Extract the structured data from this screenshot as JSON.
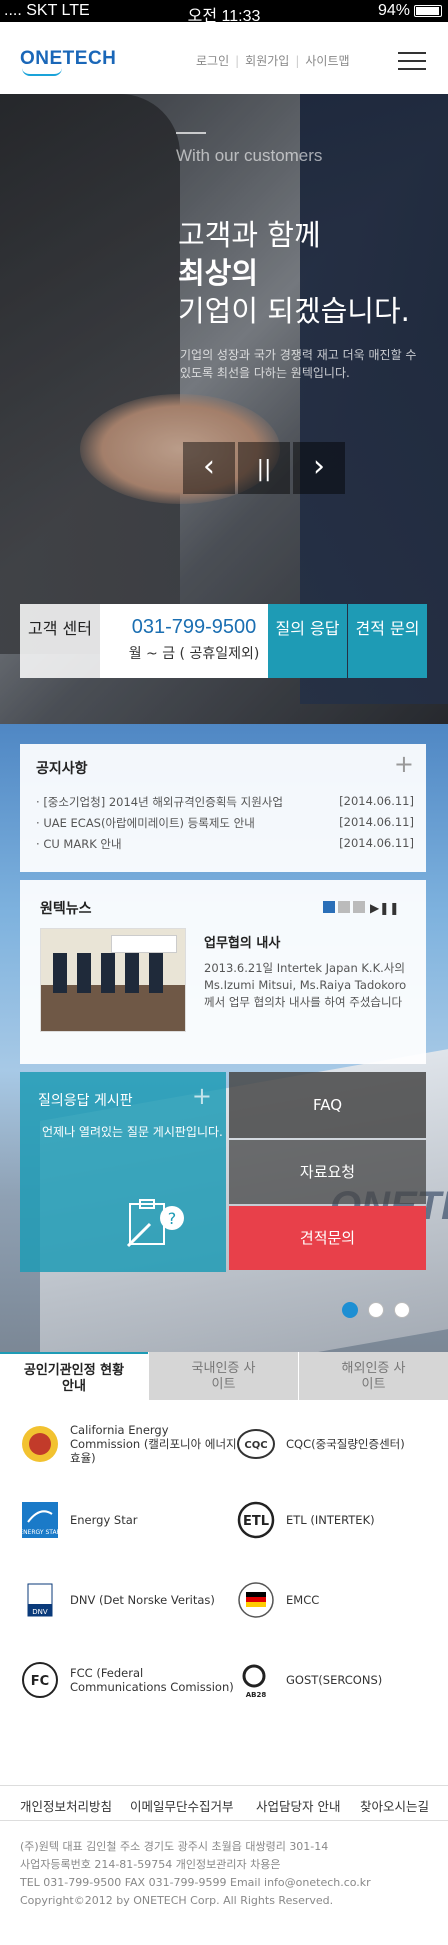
{
  "statusbar": {
    "signal": ".... SKT  LTE",
    "time": "오전 11:33",
    "battery": "94%"
  },
  "header": {
    "logo": "ONETECH",
    "links": [
      "로그인",
      "회원가입",
      "사이트맵"
    ],
    "menu_icon": "hamburger-icon"
  },
  "hero": {
    "subtitle": "With our customers",
    "headline_1": "고객과 함께",
    "headline_2": "최상의",
    "headline_3": "기업이 되겠습니다.",
    "description": "기업의 성장과 국가 경쟁력 재고 더욱 매진할 수 있도록 최선을 다하는 원텍입니다.",
    "controls": {
      "prev": "‹",
      "pause": "||",
      "next": "›"
    }
  },
  "contact": {
    "label": "고객 센터",
    "phone": "031-799-9500",
    "hours": "월 ~ 금 ( 공휴일제외)",
    "btn_qa": "질의 응답",
    "btn_estimate": "견적 문의"
  },
  "notice": {
    "title": "공지사항",
    "items": [
      {
        "text": "[중소기업청] 2014년 해외규격인증획득 지원사업",
        "date": "[2014.06.11]"
      },
      {
        "text": "UAE ECAS(아랍에미레이트) 등록제도 안내",
        "date": "[2014.06.11]"
      },
      {
        "text": "CU MARK 안내",
        "date": "[2014.06.11]"
      }
    ]
  },
  "news": {
    "title": "원텍뉴스",
    "item_title": "업무협의 내사",
    "item_desc": "2013.6.21일 Intertek Japan K.K.사의 Ms.Izumi Mitsui, Ms.Raiya Tadokoro께서 업무 협의차 내사를 하여 주셨습니다"
  },
  "qa_board": {
    "title": "질의응답 게시판",
    "desc": "언제나 열려있는 질문 게시판입니다."
  },
  "side_buttons": {
    "faq": "FAQ",
    "request": "자료요청",
    "estimate": "견적문의"
  },
  "cert_tabs": [
    "공인기관인정 현황 안내",
    "국내인증 사이트",
    "해외인증 사이트"
  ],
  "certs": [
    {
      "name": "California Energy Commission (캘리포니아 에너지효율)",
      "icon": "california-energy-commission-icon"
    },
    {
      "name": "CQC(중국질량인증센터)",
      "icon": "cqc-icon"
    },
    {
      "name": "Energy Star",
      "icon": "energy-star-icon"
    },
    {
      "name": "ETL (INTERTEK)",
      "icon": "etl-icon"
    },
    {
      "name": "DNV (Det Norske Veritas)",
      "icon": "dnv-icon"
    },
    {
      "name": "EMCC",
      "icon": "emcc-icon"
    },
    {
      "name": "FCC (Federal Communications Comission)",
      "icon": "fcc-icon"
    },
    {
      "name": "GOST(SERCONS)",
      "icon": "gost-icon"
    }
  ],
  "footer": {
    "links": [
      "개인정보처리방침",
      "이메일무단수집거부",
      "사업담당자 안내",
      "찾아오시는길"
    ],
    "info_1": "(주)원텍   대표 김인철     주소  경기도 광주시 초월읍 대쌍령리 301-14",
    "info_2": "사업자등록번호 214-81-59754    개인정보관리자 차용은",
    "info_3": "TEL  031-799-9500    FAX  031-799-9599   Email info@onetech.co.kr",
    "info_4": "Copyright©2012 by ONETECH Corp. All Rights Reserved."
  },
  "colors": {
    "brand_blue": "#1a67b8",
    "teal": "#1e9bb5",
    "red": "#e8404a"
  }
}
